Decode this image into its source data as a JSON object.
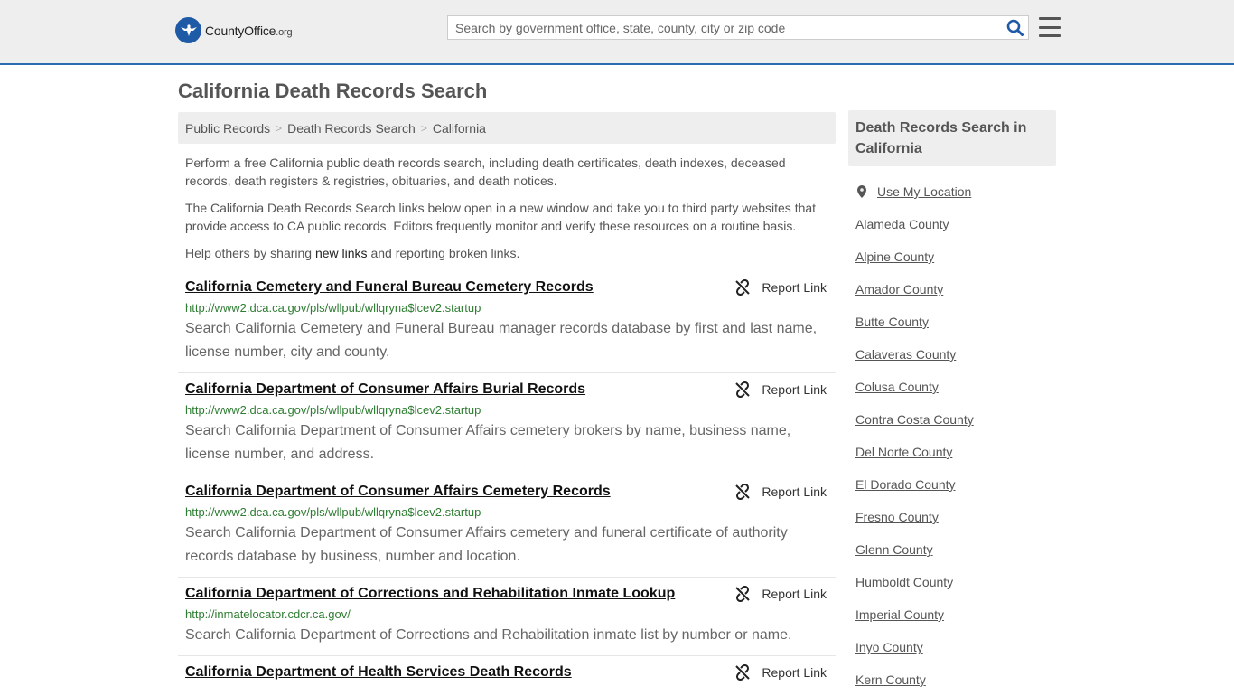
{
  "header": {
    "logo_name": "CountyOffice",
    "logo_tld": ".org",
    "search_placeholder": "Search by government office, state, county, city or zip code"
  },
  "page_title": "California Death Records Search",
  "breadcrumb": [
    "Public Records",
    "Death Records Search",
    "California"
  ],
  "intro": {
    "p1": "Perform a free California public death records search, including death certificates, death indexes, deceased records, death registers & registries, obituaries, and death notices.",
    "p2": "The California Death Records Search links below open in a new window and take you to third party websites that provide access to CA public records. Editors frequently monitor and verify these resources on a routine basis.",
    "p3_before": "Help others by sharing ",
    "p3_link": "new links",
    "p3_after": " and reporting broken links."
  },
  "report_label": "Report Link",
  "records": [
    {
      "title": "California Cemetery and Funeral Bureau Cemetery Records",
      "url": "http://www2.dca.ca.gov/pls/wllpub/wllqryna$lcev2.startup",
      "desc": "Search California Cemetery and Funeral Bureau manager records database by first and last name, license number, city and county."
    },
    {
      "title": "California Department of Consumer Affairs Burial Records",
      "url": "http://www2.dca.ca.gov/pls/wllpub/wllqryna$lcev2.startup",
      "desc": "Search California Department of Consumer Affairs cemetery brokers by name, business name, license number, and address."
    },
    {
      "title": "California Department of Consumer Affairs Cemetery Records",
      "url": "http://www2.dca.ca.gov/pls/wllpub/wllqryna$lcev2.startup",
      "desc": "Search California Department of Consumer Affairs cemetery and funeral certificate of authority records database by business, number and location."
    },
    {
      "title": "California Department of Corrections and Rehabilitation Inmate Lookup",
      "url": "http://inmatelocator.cdcr.ca.gov/",
      "desc": "Search California Department of Corrections and Rehabilitation inmate list by number or name."
    },
    {
      "title": "California Department of Health Services Death Records",
      "url": "",
      "desc": ""
    }
  ],
  "sidebar": {
    "title": "Death Records Search in California",
    "use_location": "Use My Location",
    "counties": [
      "Alameda County",
      "Alpine County",
      "Amador County",
      "Butte County",
      "Calaveras County",
      "Colusa County",
      "Contra Costa County",
      "Del Norte County",
      "El Dorado County",
      "Fresno County",
      "Glenn County",
      "Humboldt County",
      "Imperial County",
      "Inyo County",
      "Kern County"
    ]
  },
  "colors": {
    "header_bg": "#eeeeee",
    "header_border": "#2b6cb0",
    "url_green": "#2e7d32",
    "logo_blue": "#1f5aa6"
  }
}
